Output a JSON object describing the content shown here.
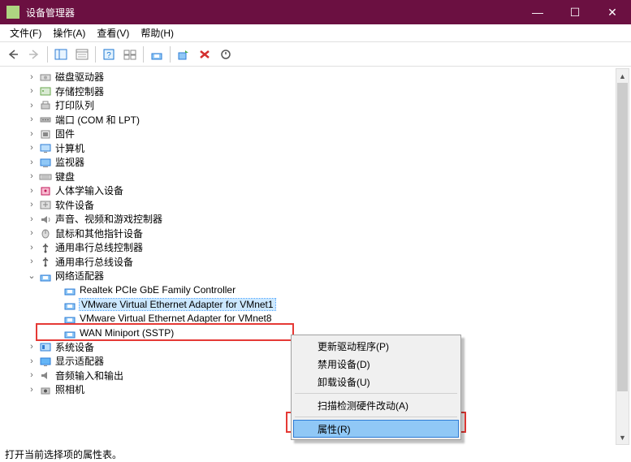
{
  "window": {
    "title": "设备管理器",
    "controls": {
      "min": "—",
      "max": "☐",
      "close": "✕"
    }
  },
  "menubar": {
    "file": "文件(F)",
    "action": "操作(A)",
    "view": "查看(V)",
    "help": "帮助(H)"
  },
  "tree": {
    "nodes": [
      {
        "label": "磁盘驱动器",
        "icon": "disk"
      },
      {
        "label": "存储控制器",
        "icon": "storage"
      },
      {
        "label": "打印队列",
        "icon": "printer"
      },
      {
        "label": "端口 (COM 和 LPT)",
        "icon": "port"
      },
      {
        "label": "固件",
        "icon": "firmware"
      },
      {
        "label": "计算机",
        "icon": "computer"
      },
      {
        "label": "监视器",
        "icon": "monitor"
      },
      {
        "label": "键盘",
        "icon": "keyboard"
      },
      {
        "label": "人体学输入设备",
        "icon": "hid"
      },
      {
        "label": "软件设备",
        "icon": "software"
      },
      {
        "label": "声音、视频和游戏控制器",
        "icon": "audio"
      },
      {
        "label": "鼠标和其他指针设备",
        "icon": "mouse"
      },
      {
        "label": "通用串行总线控制器",
        "icon": "usb"
      },
      {
        "label": "通用串行总线设备",
        "icon": "usb"
      },
      {
        "label": "网络适配器",
        "icon": "network",
        "expanded": true,
        "children": [
          {
            "label": "Realtek PCIe GbE Family Controller"
          },
          {
            "label": "VMware Virtual Ethernet Adapter for VMnet1",
            "selected": true
          },
          {
            "label": "VMware Virtual Ethernet Adapter for VMnet8"
          },
          {
            "label": "WAN Miniport (SSTP)"
          }
        ]
      },
      {
        "label": "系统设备",
        "icon": "system"
      },
      {
        "label": "显示适配器",
        "icon": "display"
      },
      {
        "label": "音频输入和输出",
        "icon": "audioio"
      },
      {
        "label": "照相机",
        "icon": "camera"
      }
    ]
  },
  "context_menu": {
    "items": [
      {
        "label": "更新驱动程序(P)"
      },
      {
        "label": "禁用设备(D)"
      },
      {
        "label": "卸载设备(U)"
      },
      {
        "sep": true
      },
      {
        "label": "扫描检测硬件改动(A)"
      },
      {
        "sep": true
      },
      {
        "label": "属性(R)",
        "highlighted": true
      }
    ]
  },
  "statusbar": {
    "text": "打开当前选择项的属性表。"
  }
}
